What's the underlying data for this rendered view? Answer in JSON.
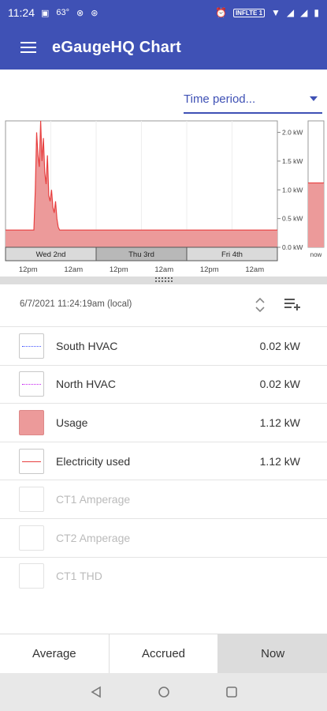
{
  "status_bar": {
    "time": "11:24",
    "temperature": "63°",
    "badge": "INFLTE 1"
  },
  "app_bar": {
    "title": "eGaugeHQ Chart"
  },
  "time_period": {
    "placeholder": "Time period..."
  },
  "chart_data": {
    "type": "area",
    "x_labels_days": [
      "Wed 2nd",
      "Thu 3rd",
      "Fri 4th"
    ],
    "x_ticks": [
      "12pm",
      "12am",
      "12pm",
      "12am",
      "12pm",
      "12am"
    ],
    "y_ticks": [
      "2.0 kW",
      "1.5 kW",
      "1.0 kW",
      "0.5 kW",
      "0.0 kW"
    ],
    "ylim": [
      0,
      2.2
    ],
    "now_label": "now",
    "now_value": 1.12,
    "series": [
      {
        "name": "Usage",
        "type": "area",
        "color": "#ec9a9a",
        "values": [
          0.3,
          0.3,
          0.3,
          0.3,
          0.3,
          0.3,
          0.3,
          0.3,
          0.3,
          0.3,
          0.3,
          0.3,
          0.3,
          0.3,
          0.3,
          0.3,
          0.3,
          0.3,
          0.3,
          0.3,
          0.3,
          0.3,
          1.0,
          2.0,
          1.6,
          1.4,
          2.2,
          1.5,
          1.9,
          1.3,
          1.1,
          1.6,
          0.9,
          0.8,
          1.0,
          0.7,
          0.6,
          0.8,
          0.5,
          0.35,
          0.3,
          0.3,
          0.3,
          0.3,
          0.3,
          0.3,
          0.3,
          0.3,
          0.3,
          0.3,
          0.3,
          0.3,
          0.3,
          0.3,
          0.3,
          0.3,
          0.3,
          0.3,
          0.3,
          0.3,
          0.3,
          0.3,
          0.3,
          0.3,
          0.3,
          0.3,
          0.3,
          0.3,
          0.3,
          0.3,
          0.3,
          0.3,
          0.3,
          0.3,
          0.3,
          0.3,
          0.3,
          0.3,
          0.3,
          0.3,
          0.3,
          0.3,
          0.3,
          0.3,
          0.3,
          0.3,
          0.3,
          0.3,
          0.3,
          0.3,
          0.3,
          0.3,
          0.3,
          0.3,
          0.3,
          0.3,
          0.3,
          0.3,
          0.3,
          0.3,
          0.3,
          0.3,
          0.3,
          0.3,
          0.3,
          0.3,
          0.3,
          0.3,
          0.3,
          0.3,
          0.3,
          0.3,
          0.3,
          0.3,
          0.3,
          0.3,
          0.3,
          0.3,
          0.3,
          0.3,
          0.3,
          0.3,
          0.3,
          0.3,
          0.3,
          0.3,
          0.3,
          0.3,
          0.3,
          0.3,
          0.3,
          0.3,
          0.3,
          0.3,
          0.3,
          0.3,
          0.3,
          0.3,
          0.3,
          0.3,
          0.3,
          0.3,
          0.3,
          0.3,
          0.3,
          0.3,
          0.3,
          0.3,
          0.3,
          0.3,
          0.3,
          0.3,
          0.3,
          0.3,
          0.3,
          0.3,
          0.3,
          0.3,
          0.3,
          0.3,
          0.3,
          0.3,
          0.3,
          0.3,
          0.3,
          0.3,
          0.3,
          0.3,
          0.3,
          0.3,
          0.3,
          0.3,
          0.3,
          0.3,
          0.3,
          0.3,
          0.3,
          0.3,
          0.3,
          0.3,
          0.3,
          0.3,
          0.3,
          0.3,
          0.3,
          0.3,
          0.3,
          0.3,
          0.3,
          0.3,
          0.3,
          0.3,
          0.3,
          0.3,
          0.3,
          0.3,
          0.3,
          0.3,
          0.3,
          0.3,
          0.3,
          0.3
        ]
      },
      {
        "name": "Electricity used",
        "type": "line",
        "color": "#e84040"
      },
      {
        "name": "South HVAC",
        "type": "dotted",
        "color": "#3f51ff"
      },
      {
        "name": "North HVAC",
        "type": "dotted",
        "color": "#c51cf0"
      }
    ]
  },
  "readout": {
    "timestamp": "6/7/2021 11:24:19am (local)"
  },
  "legend": [
    {
      "name": "South HVAC",
      "value": "0.02 kW",
      "style": "dotted-blue",
      "enabled": true
    },
    {
      "name": "North HVAC",
      "value": "0.02 kW",
      "style": "dotted-purple",
      "enabled": true
    },
    {
      "name": "Usage",
      "value": "1.12 kW",
      "style": "fill",
      "enabled": true
    },
    {
      "name": "Electricity used",
      "value": "1.12 kW",
      "style": "line",
      "enabled": true
    },
    {
      "name": "CT1 Amperage",
      "value": "",
      "style": "none",
      "enabled": false
    },
    {
      "name": "CT2 Amperage",
      "value": "",
      "style": "none",
      "enabled": false
    },
    {
      "name": "CT1 THD",
      "value": "",
      "style": "none",
      "enabled": false
    }
  ],
  "bottom_tabs": [
    {
      "label": "Average",
      "active": false
    },
    {
      "label": "Accrued",
      "active": false
    },
    {
      "label": "Now",
      "active": true
    }
  ]
}
